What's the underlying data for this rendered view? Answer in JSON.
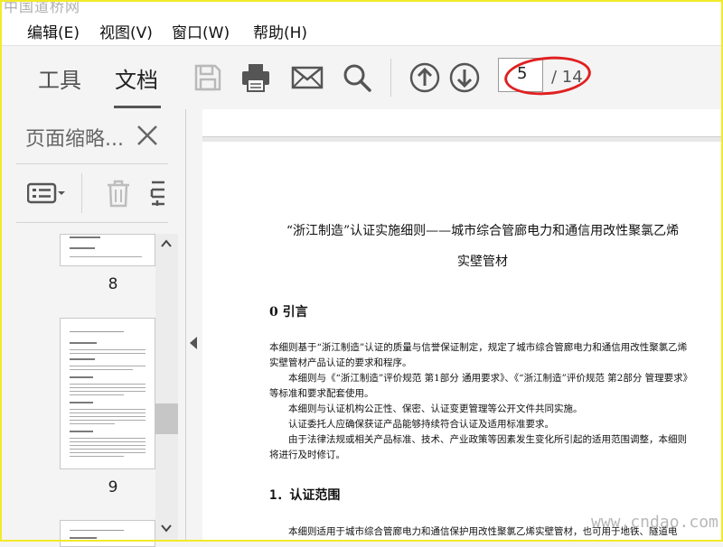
{
  "watermark": {
    "top": "中国道桥网",
    "bottom": "www.cndao.com"
  },
  "menu": [
    {
      "label": "编辑(E)"
    },
    {
      "label": "视图(V)"
    },
    {
      "label": "窗口(W)"
    },
    {
      "label": "帮助(H)"
    }
  ],
  "toolbar": {
    "tabs": [
      {
        "label": "工具"
      },
      {
        "label": "文档"
      }
    ],
    "icons": [
      "save-icon",
      "print-icon",
      "mail-icon",
      "search-icon",
      "arrow-up-icon",
      "arrow-down-icon"
    ],
    "page_current": "5",
    "page_total": "/ 14",
    "highlight_color": "#e02020"
  },
  "thumbnail_panel": {
    "title": "页面缩略...",
    "icons": [
      "options-icon",
      "trash-icon",
      "extract-icon",
      "close-icon"
    ],
    "pages": [
      {
        "label": "8"
      },
      {
        "label": "9"
      }
    ]
  },
  "document": {
    "title_line1": "“浙江制造”认证实施细则——城市综合管廊电力和通信用改性聚氯乙烯",
    "title_line2": "实壁管材",
    "section0": "0 引言",
    "para1": "本细则基于“浙江制造”认证的质量与信誉保证制定，规定了城市综合管廊电力和通信用改性聚氯乙烯实壁管材产品认证的要求和程序。",
    "para2": "本细则与《“浙江制造”评价规范  第1部分  通用要求》、《“浙江制造”评价规范  第2部分  管理要求》等标准和要求配套使用。",
    "para3": "本细则与认证机构公正性、保密、认证变更管理等公开文件共同实施。",
    "para4": "认证委托人应确保获证产品能够持续符合认证及适用标准要求。",
    "para5": "由于法律法规或相关产品标准、技术、产业政策等因素发生变化所引起的适用范围调整，本细则将进行及时修订。",
    "section1": "1．认证范围",
    "para6": "本细则适用于城市综合管廊电力和通信保护用改性聚氯乙烯实壁管材，也可用于地铁、隧道电"
  },
  "colors": {
    "frame": "#f2ea2a",
    "toolbar_bg": "#f4f4f4",
    "icon": "#555555"
  }
}
